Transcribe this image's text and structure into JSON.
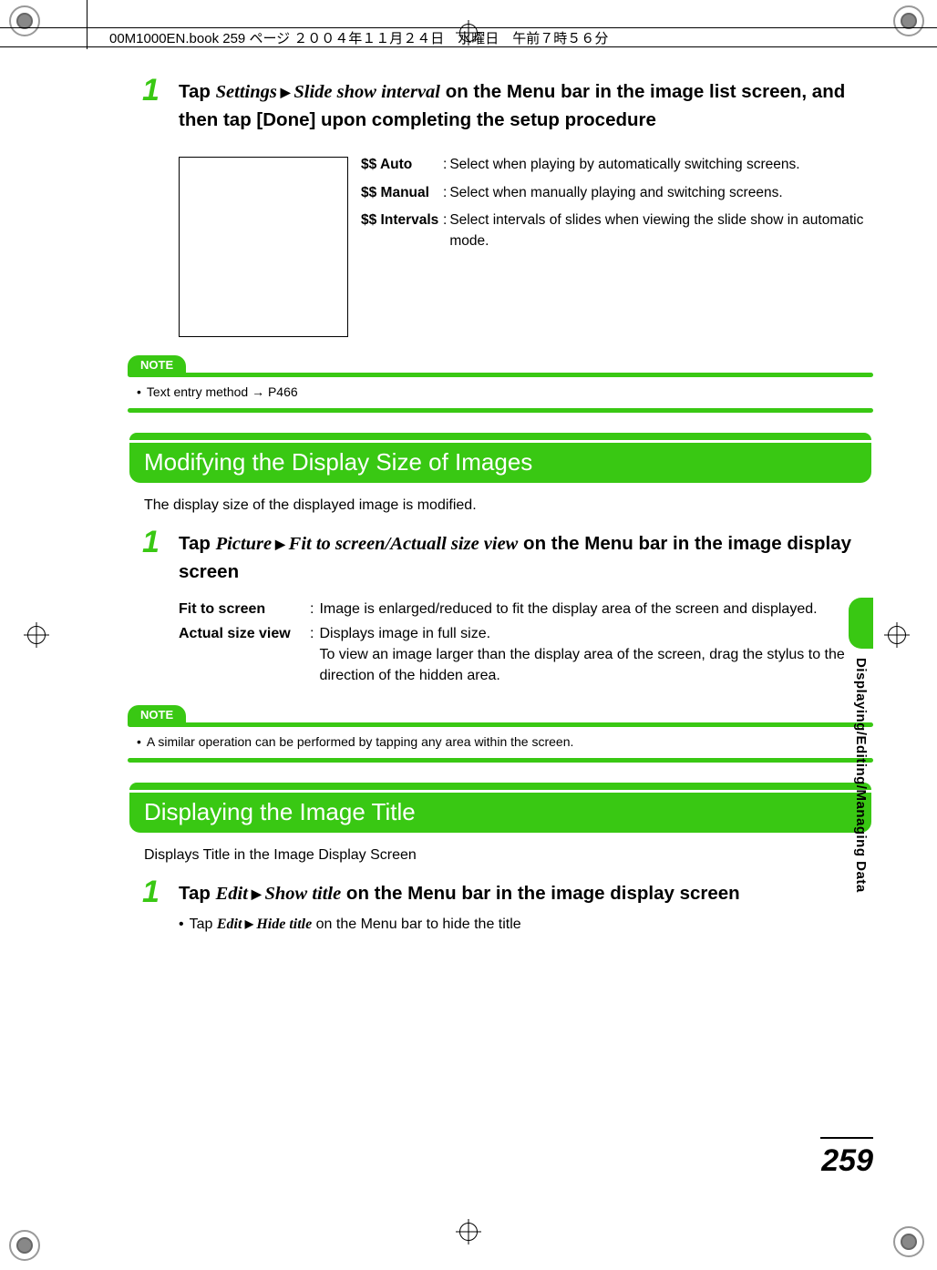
{
  "header": {
    "running_head": "00M1000EN.book  259 ページ  ２００４年１１月２４日　水曜日　午前７時５６分"
  },
  "step1_top": {
    "num": "1",
    "pre": "Tap ",
    "path1": "Settings",
    "path2": "Slide show interval",
    "post": " on the Menu bar in the image list screen, and then tap [Done] upon completing the setup procedure"
  },
  "slide_options": [
    {
      "label": "$$ Auto",
      "desc": "Select when playing by automatically switching screens."
    },
    {
      "label": "$$ Manual",
      "desc": "Select when manually playing and switching screens."
    },
    {
      "label": "$$ Intervals",
      "desc": "Select intervals of slides when viewing the slide show in automatic mode."
    }
  ],
  "note1": {
    "label": "NOTE",
    "text": "Text entry method → P466"
  },
  "section2": {
    "title": "Modifying the Display Size of Images",
    "intro": "The display size of the displayed image is modified."
  },
  "step1_mid": {
    "num": "1",
    "pre": "Tap ",
    "path1": "Picture",
    "path2": "Fit to screen/Actuall size view",
    "post": " on the Menu bar in the image display screen"
  },
  "size_defs": [
    {
      "label": "Fit to screen",
      "desc": "Image is enlarged/reduced to fit the display area of the screen and displayed."
    },
    {
      "label": "Actual size view",
      "desc": "Displays image in full size.\nTo view an image larger than the display area of the screen, drag the stylus to the direction of the hidden area."
    }
  ],
  "note2": {
    "label": "NOTE",
    "text": "A similar operation can be performed by tapping any area within the screen."
  },
  "section3": {
    "title": "Displaying the Image Title",
    "intro": "Displays Title in the Image Display Screen"
  },
  "step1_bot": {
    "num": "1",
    "pre": "Tap ",
    "path1": "Edit",
    "path2": "Show title",
    "post": " on the Menu bar in the image display screen",
    "sub_pre": "Tap ",
    "sub_path1": "Edit",
    "sub_path2": "Hide title",
    "sub_post": " on the Menu bar to hide the title"
  },
  "side_tab": "Displaying/Editing/Managing Data",
  "page_number": "259"
}
